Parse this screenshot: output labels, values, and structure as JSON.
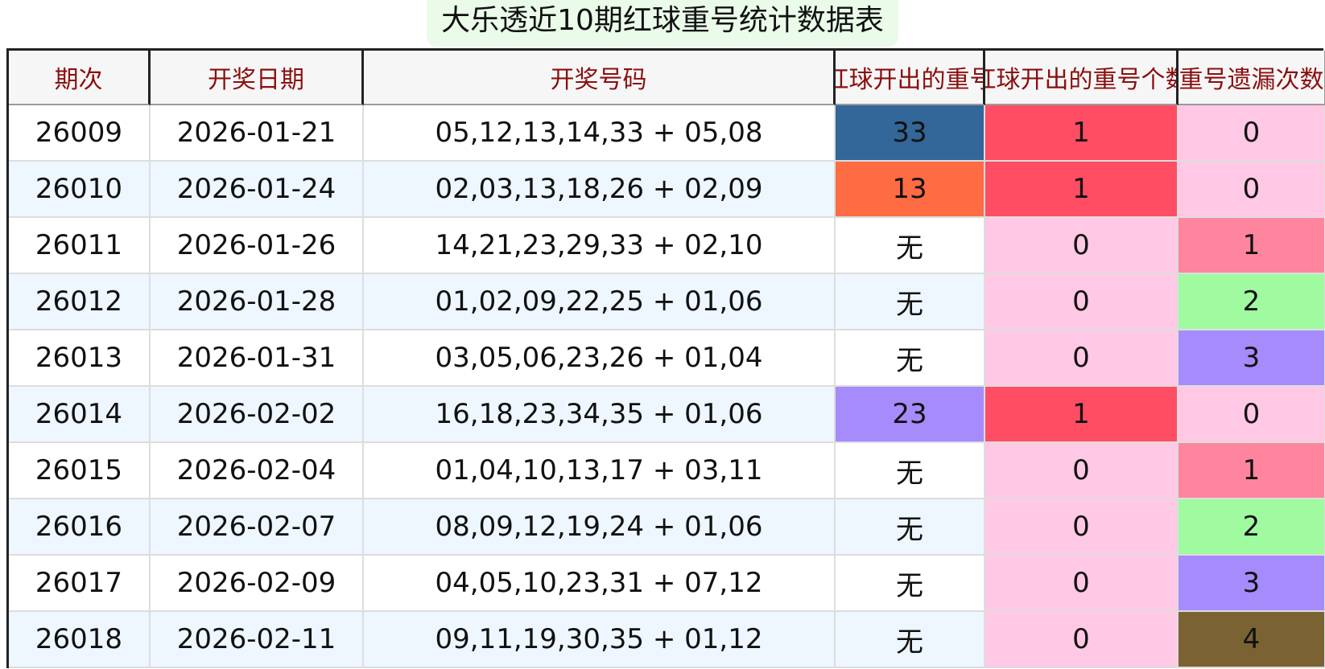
{
  "title": "大乐透近10期红球重号统计数据表",
  "headers": [
    "期次",
    "开奖日期",
    "开奖号码",
    "红球开出的重号",
    "红球开出的重号个数",
    "重号遗漏次数"
  ],
  "colors": {
    "header_text": "#8b0f0f",
    "row_alt": "#eef6ff",
    "repeat_count_1": "#ff4d63",
    "repeat_count_0": "#ffc8e4",
    "miss_0": "#ffc8e4",
    "miss_1": "#ff859f",
    "miss_2": "#9ffaa0",
    "miss_3": "#a68bfc",
    "miss_4": "#7a6233"
  },
  "rows": [
    {
      "period": "26009",
      "date": "2026-01-21",
      "numbers": "05,12,13,14,33 + 05,08",
      "repeat": "33",
      "repeat_color": "#336699",
      "count": "1",
      "miss": "0"
    },
    {
      "period": "26010",
      "date": "2026-01-24",
      "numbers": "02,03,13,18,26 + 02,09",
      "repeat": "13",
      "repeat_color": "#ff6b43",
      "count": "1",
      "miss": "0"
    },
    {
      "period": "26011",
      "date": "2026-01-26",
      "numbers": "14,21,23,29,33 + 02,10",
      "repeat": "无",
      "repeat_color": "",
      "count": "0",
      "miss": "1"
    },
    {
      "period": "26012",
      "date": "2026-01-28",
      "numbers": "01,02,09,22,25 + 01,06",
      "repeat": "无",
      "repeat_color": "",
      "count": "0",
      "miss": "2"
    },
    {
      "period": "26013",
      "date": "2026-01-31",
      "numbers": "03,05,06,23,26 + 01,04",
      "repeat": "无",
      "repeat_color": "",
      "count": "0",
      "miss": "3"
    },
    {
      "period": "26014",
      "date": "2026-02-02",
      "numbers": "16,18,23,34,35 + 01,06",
      "repeat": "23",
      "repeat_color": "#a68bfc",
      "count": "1",
      "miss": "0"
    },
    {
      "period": "26015",
      "date": "2026-02-04",
      "numbers": "01,04,10,13,17 + 03,11",
      "repeat": "无",
      "repeat_color": "",
      "count": "0",
      "miss": "1"
    },
    {
      "period": "26016",
      "date": "2026-02-07",
      "numbers": "08,09,12,19,24 + 01,06",
      "repeat": "无",
      "repeat_color": "",
      "count": "0",
      "miss": "2"
    },
    {
      "period": "26017",
      "date": "2026-02-09",
      "numbers": "04,05,10,23,31 + 07,12",
      "repeat": "无",
      "repeat_color": "",
      "count": "0",
      "miss": "3"
    },
    {
      "period": "26018",
      "date": "2026-02-11",
      "numbers": "09,11,19,30,35 + 01,12",
      "repeat": "无",
      "repeat_color": "",
      "count": "0",
      "miss": "4"
    }
  ]
}
